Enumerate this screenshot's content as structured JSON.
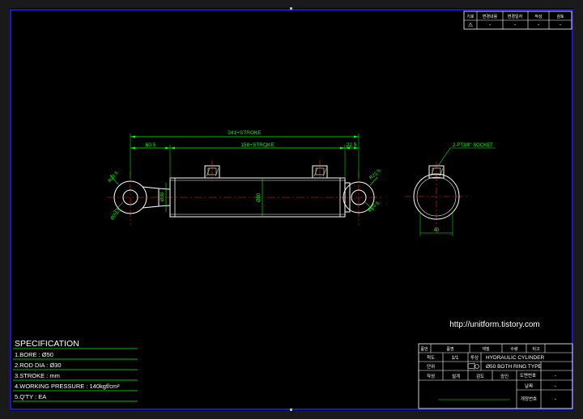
{
  "colors": {
    "background": "#000000",
    "frame": "#2020ff",
    "part": "#ffffff",
    "dimension": "#00ff00",
    "centerline": "#ff2020",
    "hatch": "#ffff00",
    "table": "#ffffff",
    "text": "#ffffff",
    "spec_text": "#ffffff"
  },
  "revision_table": {
    "headers": [
      "기호",
      "변경내용",
      "변경일자",
      "작성",
      "검토"
    ],
    "row": [
      "⚠",
      "-",
      "-",
      "-",
      "-"
    ]
  },
  "dimensions": {
    "overall": "241+STROKE",
    "left_offset": "60.5",
    "body_length": "158+STROKE",
    "right_offset": "22.5",
    "bore_dia": "Ø50",
    "rod_dia": "Ø30",
    "left_r_top": "R22.5",
    "left_hole": "Ø20.5",
    "right_r_top": "R22.5",
    "right_hole": "Ø20.5",
    "port_note": "2-PT3/8\" SOCKET",
    "side_width": "40"
  },
  "watermark": "http://unitform.tistory.com",
  "specification": {
    "title": "SPECIFICATION",
    "lines": [
      "1.BORE : Ø50",
      "2.ROD DIA : Ø30",
      "3.STROKE :      mm",
      "4.WORKING PRESSURE : 140kgf/cm²",
      "5.Q'TY :      EA"
    ]
  },
  "title_block": {
    "row1_labels": [
      "품번",
      "품명",
      "재질",
      "수량",
      "비고"
    ],
    "scale_label": "척도",
    "scale_value": "1/1",
    "projection_label": "투상",
    "part_name_line1": "HYDRAULIC CYLINDER",
    "part_name_line2": "Ø50 BOTH RING TYPE",
    "unit_label": "단위",
    "drawing_no_label": "도면번호",
    "drawing_no_value": "-",
    "sign_labels": [
      "작성",
      "설계",
      "검도",
      "승인"
    ],
    "date_label": "날짜",
    "date_value": "-",
    "rev_label": "개정번호",
    "rev_value": "-"
  }
}
